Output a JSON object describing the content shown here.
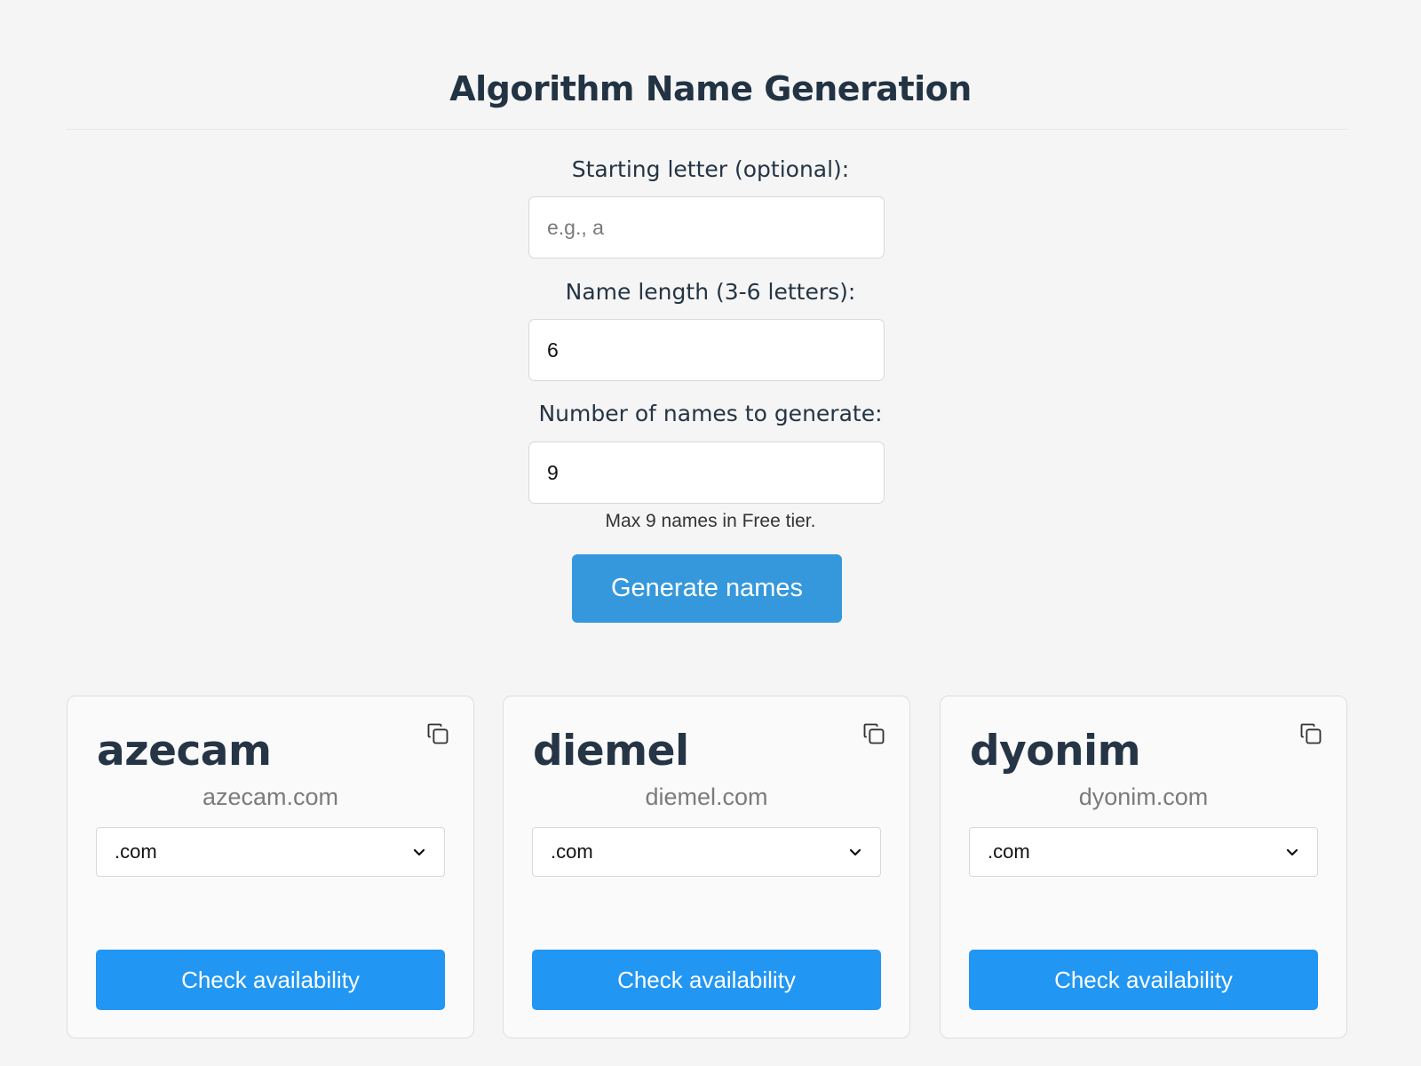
{
  "page": {
    "title": "Algorithm Name Generation"
  },
  "form": {
    "starting_letter": {
      "label": "Starting letter (optional):",
      "placeholder": "e.g., a",
      "value": ""
    },
    "name_length": {
      "label": "Name length (3-6 letters):",
      "value": "6"
    },
    "name_count": {
      "label": "Number of names to generate:",
      "value": "9"
    },
    "hint": "Max 9 names in Free tier.",
    "generate_label": "Generate names"
  },
  "results": [
    {
      "name": "azecam",
      "domain": "azecam.com",
      "tld": ".com",
      "check_label": "Check availability",
      "copy_icon": "copy-icon"
    },
    {
      "name": "diemel",
      "domain": "diemel.com",
      "tld": ".com",
      "check_label": "Check availability",
      "copy_icon": "copy-icon"
    },
    {
      "name": "dyonim",
      "domain": "dyonim.com",
      "tld": ".com",
      "check_label": "Check availability",
      "copy_icon": "copy-icon"
    }
  ],
  "colors": {
    "primary_button": "#3598dc",
    "check_button": "#2196f3",
    "background": "#f5f5f5",
    "title_text": "#223344"
  }
}
